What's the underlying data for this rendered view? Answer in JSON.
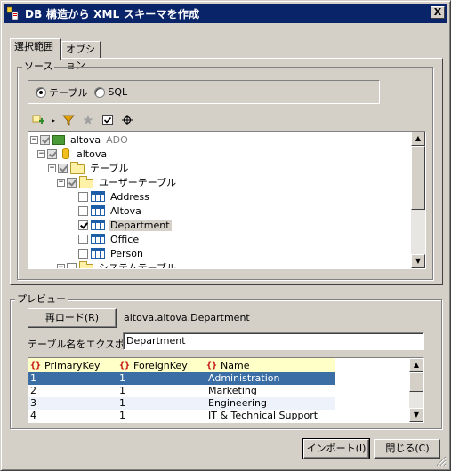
{
  "window": {
    "title": "DB 構造から XML スキーマを作成",
    "close_label": "X"
  },
  "tabs": [
    {
      "label": "選択範囲",
      "active": true
    },
    {
      "label": "オプション",
      "active": false
    }
  ],
  "source": {
    "group_label": "ソース",
    "radio_table": "テーブル",
    "radio_sql": "SQL",
    "selected": "テーブル"
  },
  "toolbar": {
    "icons": [
      "add-connection-icon",
      "dropdown-arrow-icon",
      "filter-icon",
      "star-icon",
      "checkbox-icon",
      "locate-icon"
    ]
  },
  "tree": {
    "root": {
      "label": "altova",
      "sub": "ADO"
    },
    "database": "altova",
    "tables_folder": "テーブル",
    "user_tables_folder": "ユーザーテーブル",
    "tables": [
      {
        "name": "Address",
        "checked": false
      },
      {
        "name": "Altova",
        "checked": false
      },
      {
        "name": "Department",
        "checked": true
      },
      {
        "name": "Office",
        "checked": false
      },
      {
        "name": "Person",
        "checked": false
      }
    ],
    "system_tables_folder": "システムテーブル"
  },
  "preview": {
    "group_label": "プレビュー",
    "reload_button": "再ロード(R)",
    "current_table": "altova.altova.Department",
    "export_label": "テーブル名をエクスポート：",
    "export_value": "Department",
    "columns": [
      "PrimaryKey",
      "ForeignKey",
      "Name"
    ],
    "rows": [
      [
        "1",
        "1",
        "Administration"
      ],
      [
        "2",
        "1",
        "Marketing"
      ],
      [
        "3",
        "1",
        "Engineering"
      ],
      [
        "4",
        "1",
        "IT & Technical Support"
      ]
    ]
  },
  "buttons": {
    "import": "インポート(I)",
    "close": "閉じる(C)"
  }
}
